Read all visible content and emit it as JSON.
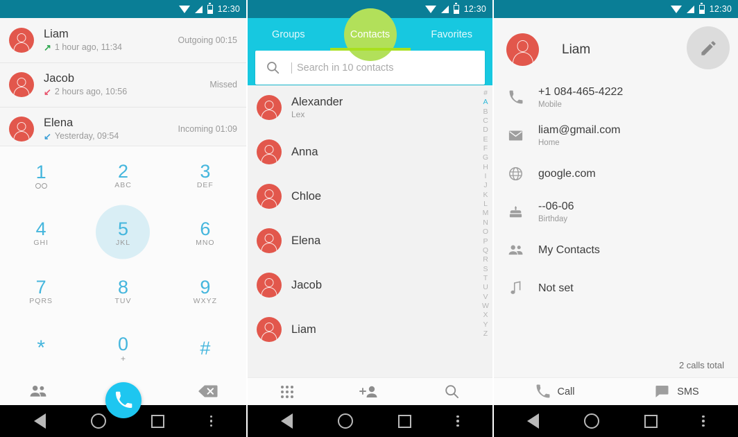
{
  "status_bar": {
    "time": "12:30",
    "icons": [
      "wifi-icon",
      "signal-icon",
      "battery-icon"
    ]
  },
  "colors": {
    "status_teal": "#0a7e96",
    "tab_cyan": "#17c8e0",
    "tab_highlight_green": "#a8e01f",
    "avatar_red": "#e2574c",
    "fab_blue": "#1ec6f0",
    "dial_blue": "#45b6dd",
    "outgoing_green": "#2fa84f",
    "missed_red": "#e8526b",
    "incoming_blue": "#3c9fd6"
  },
  "panel1": {
    "name": "call-log-dialer",
    "call_log": [
      {
        "name": "Liam",
        "arrow": "↗",
        "arrow_type": "outgoing",
        "time": "1 hour ago, 11:34",
        "status": "Outgoing 00:15"
      },
      {
        "name": "Jacob",
        "arrow": "↙",
        "arrow_type": "missed",
        "time": "2 hours ago, 10:56",
        "status": "Missed"
      },
      {
        "name": "Elena",
        "arrow": "↙",
        "arrow_type": "incoming",
        "time": "Yesterday, 09:54",
        "status": "Incoming 01:09"
      }
    ],
    "dialpad": [
      {
        "digit": "1",
        "sub": "",
        "icon": "voicemail-icon",
        "pressed": false
      },
      {
        "digit": "2",
        "sub": "ABC",
        "icon": "",
        "pressed": false
      },
      {
        "digit": "3",
        "sub": "DEF",
        "icon": "",
        "pressed": false
      },
      {
        "digit": "4",
        "sub": "GHI",
        "icon": "",
        "pressed": false
      },
      {
        "digit": "5",
        "sub": "JKL",
        "icon": "",
        "pressed": true
      },
      {
        "digit": "6",
        "sub": "MNO",
        "icon": "",
        "pressed": false
      },
      {
        "digit": "7",
        "sub": "PQRS",
        "icon": "",
        "pressed": false
      },
      {
        "digit": "8",
        "sub": "TUV",
        "icon": "",
        "pressed": false
      },
      {
        "digit": "9",
        "sub": "WXYZ",
        "icon": "",
        "pressed": false
      },
      {
        "digit": "*",
        "sub": "",
        "icon": "",
        "pressed": false
      },
      {
        "digit": "0",
        "sub": "+",
        "icon": "",
        "pressed": false
      },
      {
        "digit": "#",
        "sub": "",
        "icon": "",
        "pressed": false
      }
    ],
    "bottom_bar": {
      "contacts_icon": "people-icon",
      "call_button": "call-icon",
      "backspace_icon": "backspace-icon"
    }
  },
  "panel2": {
    "name": "contacts-list",
    "tabs": [
      {
        "label": "Groups",
        "active": false
      },
      {
        "label": "Contacts",
        "active": true
      },
      {
        "label": "Favorites",
        "active": false
      }
    ],
    "search": {
      "placeholder": "Search in 10 contacts",
      "value": "",
      "icon": "search-icon"
    },
    "contacts": [
      {
        "name": "Alexander",
        "nickname": "Lex"
      },
      {
        "name": "Anna",
        "nickname": ""
      },
      {
        "name": "Chloe",
        "nickname": ""
      },
      {
        "name": "Elena",
        "nickname": ""
      },
      {
        "name": "Jacob",
        "nickname": ""
      },
      {
        "name": "Liam",
        "nickname": ""
      }
    ],
    "alpha_index": [
      "#",
      "A",
      "B",
      "C",
      "D",
      "E",
      "F",
      "G",
      "H",
      "I",
      "J",
      "K",
      "L",
      "M",
      "N",
      "O",
      "P",
      "Q",
      "R",
      "S",
      "T",
      "U",
      "V",
      "W",
      "X",
      "Y",
      "Z"
    ],
    "alpha_selected": "A",
    "bottom_bar": {
      "dialpad_icon": "dialpad-icon",
      "add_contact_icon": "person-add-icon",
      "search_icon": "search-icon"
    }
  },
  "panel3": {
    "name": "contact-detail",
    "contact_name": "Liam",
    "edit_icon": "pencil-icon",
    "fields": [
      {
        "icon": "phone-icon",
        "value": "+1 084-465-4222",
        "label": "Mobile"
      },
      {
        "icon": "email-icon",
        "value": "liam@gmail.com",
        "label": "Home"
      },
      {
        "icon": "globe-icon",
        "value": "google.com",
        "label": ""
      },
      {
        "icon": "cake-icon",
        "value": "--06-06",
        "label": "Birthday"
      },
      {
        "icon": "people-icon",
        "value": "My Contacts",
        "label": ""
      },
      {
        "icon": "music-icon",
        "value": "Not set",
        "label": ""
      }
    ],
    "calls_total": "2 calls total",
    "actions": [
      {
        "label": "Call",
        "icon": "phone-icon"
      },
      {
        "label": "SMS",
        "icon": "message-icon"
      }
    ]
  },
  "nav_bar": {
    "back": "back-triangle-icon",
    "home": "home-circle-icon",
    "recents": "recents-square-icon",
    "menu": "overflow-menu-icon"
  }
}
